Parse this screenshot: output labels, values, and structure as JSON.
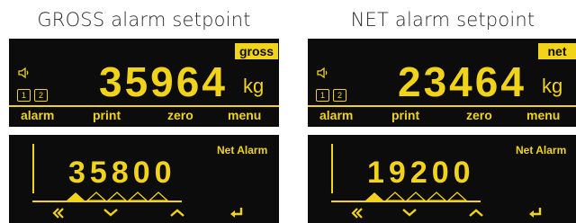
{
  "colors": {
    "display_bg": "#0c0c0c",
    "display_fg": "#f1d31a",
    "page_bg": "#ffffff"
  },
  "panels": [
    {
      "caption": "GROSS alarm setpoint",
      "top": {
        "badge": "gross",
        "icons": [
          "speaker-icon"
        ],
        "channels": [
          "1",
          "2"
        ],
        "value": "35964",
        "unit": "kg",
        "function_keys": [
          "alarm",
          "print",
          "zero",
          "menu"
        ]
      },
      "bottom": {
        "label": "Net Alarm",
        "entry": "35800",
        "digit_markers": [
          true,
          false,
          false,
          false,
          false
        ],
        "keys": [
          "rewind-icon",
          "chevron-down-icon",
          "chevron-up-icon",
          "enter-icon"
        ]
      }
    },
    {
      "caption": "NET alarm setpoint",
      "top": {
        "badge": "net",
        "icons": [
          "speaker-icon"
        ],
        "channels": [
          "1",
          "2"
        ],
        "value": "23464",
        "unit": "kg",
        "function_keys": [
          "alarm",
          "print",
          "zero",
          "menu"
        ]
      },
      "bottom": {
        "label": "Net Alarm",
        "entry": "19200",
        "digit_markers": [
          true,
          false,
          false,
          false,
          false
        ],
        "keys": [
          "rewind-icon",
          "chevron-down-icon",
          "chevron-up-icon",
          "enter-icon"
        ]
      }
    }
  ]
}
